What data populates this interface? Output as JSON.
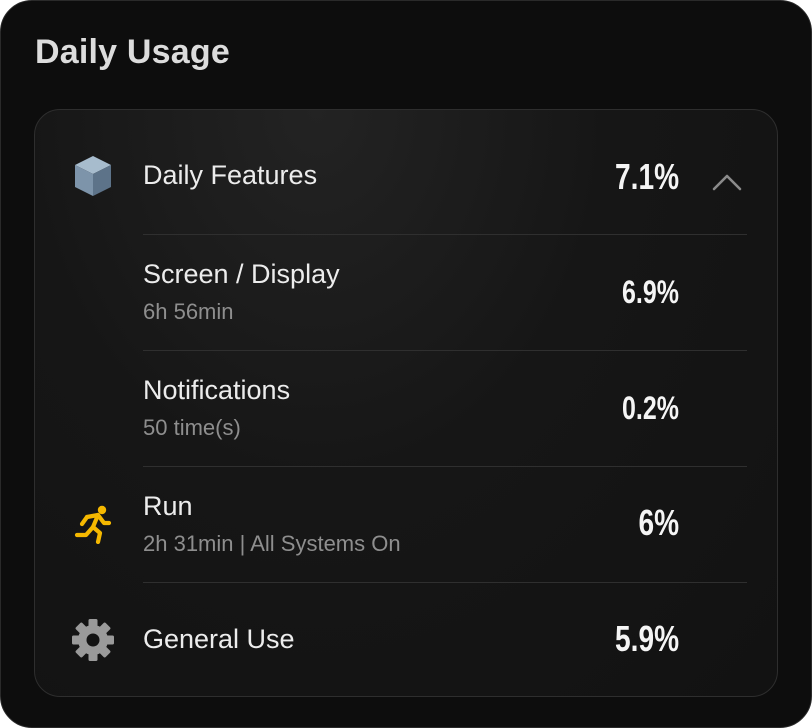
{
  "header": {
    "title": "Daily Usage"
  },
  "features": {
    "label": "Daily Features",
    "percent": "7.1%",
    "expanded": true,
    "icon": "cube-icon",
    "items": [
      {
        "label": "Screen / Display",
        "detail": "6h 56min",
        "percent": "6.9%"
      },
      {
        "label": "Notifications",
        "detail": "50 time(s)",
        "percent": "0.2%"
      }
    ]
  },
  "run": {
    "label": "Run",
    "detail": "2h 31min | All Systems On",
    "percent": "6%",
    "icon": "running-person-icon"
  },
  "general": {
    "label": "General Use",
    "percent": "5.9%",
    "icon": "gear-icon"
  },
  "colors": {
    "background": "#0d0d0d",
    "card": "#161616",
    "run_icon": "#f5b800",
    "cube_icon": "#7d94aa",
    "gear_icon": "#9a9a9a"
  }
}
